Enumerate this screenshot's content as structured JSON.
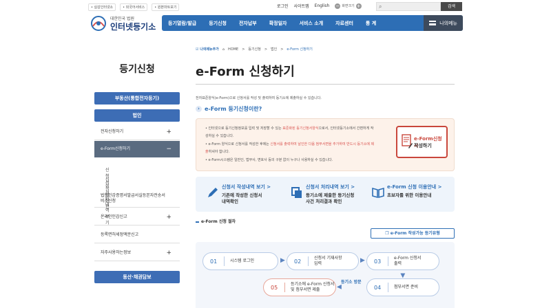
{
  "header": {
    "top_links": [
      "• 실감인터넷소",
      "• 외국어서비스",
      "• 원본마트보기"
    ],
    "util": {
      "login": "로그인",
      "sitemap": "사이트맵",
      "english": "English",
      "zoom_label": "화면크기",
      "zoom_out": "−",
      "zoom_in": "+"
    },
    "search": {
      "placeholder": "",
      "button": "검색"
    },
    "logo": {
      "small": "대한민국 법원",
      "big": "인터넷등기소"
    },
    "gnb": [
      "등기열람/발급",
      "등기신청",
      "전자납부",
      "확정일자",
      "서비스 소개",
      "자료센터",
      "통 계"
    ],
    "my_menu": "나의메뉴"
  },
  "sidebar": {
    "title": "등기신청",
    "btn_property": "부동산(통합전자등기)",
    "btn_corp": "법인",
    "items": [
      {
        "label": "전자신청하기",
        "pm": "+"
      },
      {
        "label": "e-Form신청하기",
        "pm": "−"
      },
      {
        "label": "법인인감증명서발급서실등본자전송서비스신청",
        "pm": ""
      },
      {
        "label": "온라인인감신고",
        "pm": "+"
      },
      {
        "label": "등록면허세정액분신고",
        "pm": ""
      },
      {
        "label": "자주사용하는정보",
        "pm": "+"
      }
    ],
    "subitems": [
      "신청서작성현황",
      "신청처리내역 보기"
    ],
    "btn_lien": "동산·채권담보"
  },
  "breadcrumb": {
    "fav": "나의메뉴추가",
    "items": [
      "HOME",
      ">",
      "등기신청",
      ">",
      "법인",
      ">"
    ],
    "current": "e-Form 신청하기"
  },
  "page": {
    "title": "e-Form 신청하기",
    "intro": "전자표준양식(e-Form)으로 신청서를 작성 및 출력하여 등기소에 제출하실 수 있습니다.",
    "subtitle": "e-Form 등기신청이란?",
    "notice": [
      {
        "pre": "• 인터넷으로 등기신청정보를 입력 및 저장할 수 있는 ",
        "red": "표준화된 등기신청서양식",
        "post": "으로서, 인터넷등기소에서 간편하게 작"
      },
      {
        "pre": "  성하실 수 있습니다.",
        "red": "",
        "post": ""
      },
      {
        "pre": "• e-Form 양식으로 신청서를 작성한 후에는 ",
        "red": "신청서를 출력하여 날인한 다음 첨부서면을 추가하여 반드시 등기소에 제",
        "post": ""
      },
      {
        "pre": "  ",
        "red": "출",
        "post": "하셔야 합니다."
      },
      {
        "pre": "• e-Form시스템은 일반인, 법무사, 변호사 등의 구분 없이 누구나 사용하실 수 있습니다.",
        "red": "",
        "post": ""
      }
    ],
    "eform_button": {
      "line1": "e-Form신청서",
      "line2": "작성하기"
    },
    "cards": [
      {
        "title": "신청서 작성내역 보기 >",
        "desc1": "기존에 작성한 신청서",
        "desc2": "내역확인"
      },
      {
        "title": "신청서 처리내역 보기 >",
        "desc1": "등기소에 제출한 등기신청",
        "desc2": "사건 처리결과 확인"
      },
      {
        "title": "e-Form 신청 이용안내 >",
        "desc1": "초보자를 위한 이용안내",
        "desc2": ""
      }
    ],
    "process_title": "e-Form 신청 절차",
    "avail_button": "e-Form 작성가능 등기유형",
    "steps": [
      {
        "n": "01",
        "d1": "시스템 로그인",
        "d2": ""
      },
      {
        "n": "02",
        "d1": "신청서 기재사항",
        "d2": "입력"
      },
      {
        "n": "03",
        "d1": "e-Form 신청서",
        "d2": "출력"
      },
      {
        "n": "04",
        "d1": "첨부서면 준비",
        "d2": ""
      },
      {
        "n": "05",
        "d1": "등기소에 e-Form 신청서",
        "d2": "및 첨부서면 제출"
      }
    ],
    "visit": "등기소 방문"
  }
}
